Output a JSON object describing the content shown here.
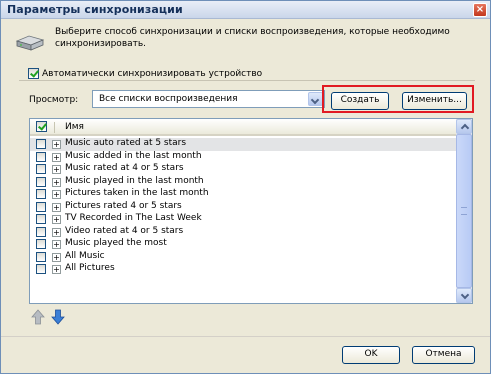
{
  "window": {
    "title": "Параметры синхронизации",
    "close_label": "×"
  },
  "intro": {
    "text": "Выберите способ синхронизации и списки воспроизведения, которые необходимо синхронизировать."
  },
  "auto_sync": {
    "label": "Автоматически синхронизировать устройство",
    "checked": true
  },
  "view": {
    "label": "Просмотр:",
    "selected": "Все списки воспроизведения"
  },
  "buttons": {
    "create": "Создать",
    "edit": "Изменить...",
    "ok": "OK",
    "cancel": "Отмена"
  },
  "list": {
    "header_name": "Имя",
    "rows": [
      "Music auto rated at 5 stars",
      "Music added in the last month",
      "Music rated at 4 or 5 stars",
      "Music played in the last month",
      "Pictures taken in the last month",
      "Pictures rated 4 or 5 stars",
      "TV Recorded in The Last Week",
      "Video rated at 4 or 5 stars",
      "Music played the most",
      "All Music",
      "All Pictures"
    ],
    "selected_index": 0
  },
  "icons": {
    "drive": "portable-device-icon",
    "move_up": "move-up-arrow-icon",
    "move_down": "move-down-arrow-icon",
    "expander_glyph": "+"
  },
  "colors": {
    "highlight": "#e11a22",
    "window_bg": "#ece9d8"
  }
}
